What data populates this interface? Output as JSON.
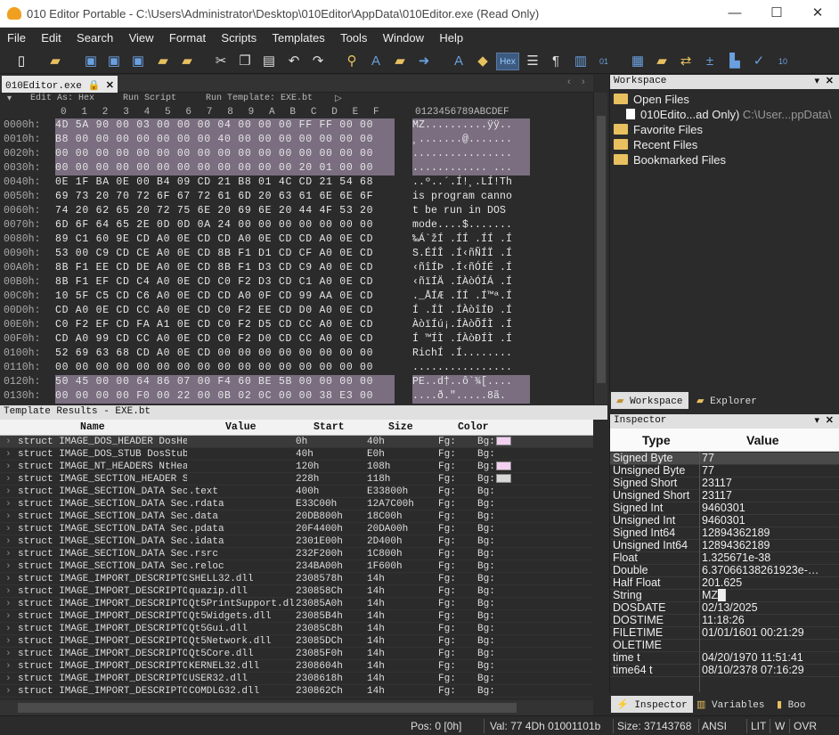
{
  "window": {
    "title": "010 Editor Portable - C:\\Users\\Administrator\\Desktop\\010Editor\\AppData\\010Editor.exe (Read Only)",
    "min": "—",
    "max": "☐",
    "close": "✕"
  },
  "menu": [
    "File",
    "Edit",
    "Search",
    "View",
    "Format",
    "Scripts",
    "Templates",
    "Tools",
    "Window",
    "Help"
  ],
  "toolbar": {
    "hex_label": "Hex"
  },
  "editor_tab": {
    "label": "010Editor.exe"
  },
  "editbar": {
    "edit_as": "Edit As: Hex",
    "run_script": "Run Script",
    "run_template": "Run Template: EXE.bt"
  },
  "hex_header": {
    "cols": "0  1  2  3  4  5  6  7  8  9  A  B  C  D  E  F",
    "ascii": "0123456789ABCDEF"
  },
  "hex_rows": [
    {
      "addr": "0000h:",
      "bytes": "4D 5A 90 00 03 00 00 00 04 00 00 00 FF FF 00 00",
      "ascii": "MZ..........ÿÿ.."
    },
    {
      "addr": "0010h:",
      "bytes": "B8 00 00 00 00 00 00 00 40 00 00 00 00 00 00 00",
      "ascii": "¸.......@......."
    },
    {
      "addr": "0020h:",
      "bytes": "00 00 00 00 00 00 00 00 00 00 00 00 00 00 00 00",
      "ascii": "................"
    },
    {
      "addr": "0030h:",
      "bytes": "00 00 00 00 00 00 00 00 00 00 00 00 20 01 00 00",
      "ascii": "............ ..."
    },
    {
      "addr": "0040h:",
      "bytes": "0E 1F BA 0E 00 B4 09 CD 21 B8 01 4C CD 21 54 68",
      "ascii": "..º..´.Í!¸.LÍ!Th"
    },
    {
      "addr": "0050h:",
      "bytes": "69 73 20 70 72 6F 67 72 61 6D 20 63 61 6E 6E 6F",
      "ascii": "is program canno"
    },
    {
      "addr": "0060h:",
      "bytes": "74 20 62 65 20 72 75 6E 20 69 6E 20 44 4F 53 20",
      "ascii": "t be run in DOS "
    },
    {
      "addr": "0070h:",
      "bytes": "6D 6F 64 65 2E 0D 0D 0A 24 00 00 00 00 00 00 00",
      "ascii": "mode....$......."
    },
    {
      "addr": "0080h:",
      "bytes": "89 C1 60 9E CD A0 0E CD CD A0 0E CD CD A0 0E CD",
      "ascii": "‰Á`žÍ .ÍÍ .ÍÍ .Í"
    },
    {
      "addr": "0090h:",
      "bytes": "53 00 C9 CD CE A0 0E CD 8B F1 D1 CD CF A0 0E CD",
      "ascii": "S.ÉÍÎ .Í‹ñÑÍÏ .Í"
    },
    {
      "addr": "00A0h:",
      "bytes": "8B F1 EE CD DE A0 0E CD 8B F1 D3 CD C9 A0 0E CD",
      "ascii": "‹ñîÍÞ .Í‹ñÓÍÉ .Í"
    },
    {
      "addr": "00B0h:",
      "bytes": "8B F1 EF CD C4 A0 0E CD C0 F2 D3 CD C1 A0 0E CD",
      "ascii": "‹ñïÍÄ .ÍÀòÓÍÁ .Í"
    },
    {
      "addr": "00C0h:",
      "bytes": "10 5F C5 CD C6 A0 0E CD CD A0 0F CD 99 AA 0E CD",
      "ascii": "._ÅÍÆ .ÍÍ .Í™ª.Í"
    },
    {
      "addr": "00D0h:",
      "bytes": "CD A0 0E CD CC A0 0E CD C0 F2 EE CD D0 A0 0E CD",
      "ascii": "Í .ÍÌ .ÍÀòîÍÐ .Í"
    },
    {
      "addr": "00E0h:",
      "bytes": "C0 F2 EF CD FA A1 0E CD C0 F2 D5 CD CC A0 0E CD",
      "ascii": "ÀòïÍú¡.ÍÀòÕÍÌ .Í"
    },
    {
      "addr": "00F0h:",
      "bytes": "CD A0 99 CD CC A0 0E CD C0 F2 D0 CD CC A0 0E CD",
      "ascii": "Í ™ÍÌ .ÍÀòÐÍÌ .Í"
    },
    {
      "addr": "0100h:",
      "bytes": "52 69 63 68 CD A0 0E CD 00 00 00 00 00 00 00 00",
      "ascii": "RichÍ .Í........"
    },
    {
      "addr": "0110h:",
      "bytes": "00 00 00 00 00 00 00 00 00 00 00 00 00 00 00 00",
      "ascii": "................"
    },
    {
      "addr": "0120h:",
      "bytes": "50 45 00 00 64 86 07 00 F4 60 BE 5B 00 00 00 00",
      "ascii": "PE..d†..ô`¾[...."
    },
    {
      "addr": "0130h:",
      "bytes": "00 00 00 00 F0 00 22 00 0B 02 0C 00 00 38 E3 00",
      "ascii": "....ð.\".....8ã."
    }
  ],
  "template_results": {
    "title": "Template Results - EXE.bt",
    "columns": [
      "Name",
      "Value",
      "Start",
      "Size",
      "Color"
    ],
    "rows": [
      [
        "struct IMAGE_DOS_HEADER DosHe…",
        "",
        "0h",
        "40h",
        "Fg:",
        "Bg:",
        "#f3d0f0"
      ],
      [
        "struct IMAGE_DOS_STUB DosStub",
        "",
        "40h",
        "E0h",
        "Fg:",
        "Bg:",
        ""
      ],
      [
        "struct IMAGE_NT_HEADERS NtHea…",
        "",
        "120h",
        "108h",
        "Fg:",
        "Bg:",
        "#f3d0f0"
      ],
      [
        "struct IMAGE_SECTION_HEADER S…",
        "",
        "228h",
        "118h",
        "Fg:",
        "Bg:",
        "#d8d8d8"
      ],
      [
        "struct IMAGE_SECTION_DATA Sec…",
        ".text",
        "400h",
        "E33800h",
        "Fg:",
        "Bg:",
        ""
      ],
      [
        "struct IMAGE_SECTION_DATA Sec…",
        ".rdata",
        "E33C00h",
        "12A7C00h",
        "Fg:",
        "Bg:",
        ""
      ],
      [
        "struct IMAGE_SECTION_DATA Sec…",
        ".data",
        "20DB800h",
        "18C00h",
        "Fg:",
        "Bg:",
        ""
      ],
      [
        "struct IMAGE_SECTION_DATA Sec…",
        ".pdata",
        "20F4400h",
        "20DA00h",
        "Fg:",
        "Bg:",
        ""
      ],
      [
        "struct IMAGE_SECTION_DATA Sec…",
        ".idata",
        "2301E00h",
        "2D400h",
        "Fg:",
        "Bg:",
        ""
      ],
      [
        "struct IMAGE_SECTION_DATA Sec…",
        ".rsrc",
        "232F200h",
        "1C800h",
        "Fg:",
        "Bg:",
        ""
      ],
      [
        "struct IMAGE_SECTION_DATA Sec…",
        ".reloc",
        "234BA00h",
        "1F600h",
        "Fg:",
        "Bg:",
        ""
      ],
      [
        "struct IMAGE_IMPORT_DESCRIPTO…",
        "SHELL32.dll",
        "2308578h",
        "14h",
        "Fg:",
        "Bg:",
        ""
      ],
      [
        "struct IMAGE_IMPORT_DESCRIPTO…",
        "quazip.dll",
        "230858Ch",
        "14h",
        "Fg:",
        "Bg:",
        ""
      ],
      [
        "struct IMAGE_IMPORT_DESCRIPTO…",
        "Qt5PrintSupport.dll",
        "23085A0h",
        "14h",
        "Fg:",
        "Bg:",
        ""
      ],
      [
        "struct IMAGE_IMPORT_DESCRIPTO…",
        "Qt5Widgets.dll",
        "23085B4h",
        "14h",
        "Fg:",
        "Bg:",
        ""
      ],
      [
        "struct IMAGE_IMPORT_DESCRIPTO…",
        "Qt5Gui.dll",
        "23085C8h",
        "14h",
        "Fg:",
        "Bg:",
        ""
      ],
      [
        "struct IMAGE_IMPORT_DESCRIPTO…",
        "Qt5Network.dll",
        "23085DCh",
        "14h",
        "Fg:",
        "Bg:",
        ""
      ],
      [
        "struct IMAGE_IMPORT_DESCRIPTO…",
        "Qt5Core.dll",
        "23085F0h",
        "14h",
        "Fg:",
        "Bg:",
        ""
      ],
      [
        "struct IMAGE_IMPORT_DESCRIPTO…",
        "KERNEL32.dll",
        "2308604h",
        "14h",
        "Fg:",
        "Bg:",
        ""
      ],
      [
        "struct IMAGE_IMPORT_DESCRIPTO…",
        "USER32.dll",
        "2308618h",
        "14h",
        "Fg:",
        "Bg:",
        ""
      ],
      [
        "struct IMAGE_IMPORT_DESCRIPTO…",
        "COMDLG32.dll",
        "230862Ch",
        "14h",
        "Fg:",
        "Bg:",
        ""
      ]
    ]
  },
  "workspace": {
    "title": "Workspace",
    "open_files": "Open Files",
    "open_file": "010Edito...ad Only)",
    "open_path": "C:\\User...ppData\\",
    "favorite": "Favorite Files",
    "recent": "Recent Files",
    "bookmarked": "Bookmarked Files",
    "tab_workspace": "Workspace",
    "tab_explorer": "Explorer"
  },
  "inspector": {
    "title": "Inspector",
    "col_type": "Type",
    "col_value": "Value",
    "rows": [
      [
        "Signed Byte",
        "77"
      ],
      [
        "Unsigned Byte",
        "77"
      ],
      [
        "Signed Short",
        "23117"
      ],
      [
        "Unsigned Short",
        "23117"
      ],
      [
        "Signed Int",
        "9460301"
      ],
      [
        "Unsigned Int",
        "9460301"
      ],
      [
        "Signed Int64",
        "12894362189"
      ],
      [
        "Unsigned Int64",
        "12894362189"
      ],
      [
        "Float",
        "1.325671e-38"
      ],
      [
        "Double",
        "6.37066138261923e-…"
      ],
      [
        "Half Float",
        "201.625"
      ],
      [
        "String",
        "MZ█"
      ],
      [
        "DOSDATE",
        "02/13/2025"
      ],
      [
        "DOSTIME",
        "11:18:26"
      ],
      [
        "FILETIME",
        "01/01/1601 00:21:29"
      ],
      [
        "OLETIME",
        ""
      ],
      [
        "time t",
        "04/20/1970 11:51:41"
      ],
      [
        "time64 t",
        "08/10/2378 07:16:29"
      ]
    ],
    "tab_inspector": "Inspector",
    "tab_variables": "Variables",
    "tab_bookmarks": "Boo"
  },
  "status": {
    "pos": "Pos: 0 [0h]",
    "val": "Val: 77 4Dh 01001101b",
    "size": "Size: 37143768",
    "enc": "ANSI",
    "lit": "LIT",
    "w": "W",
    "ovr": "OVR"
  }
}
